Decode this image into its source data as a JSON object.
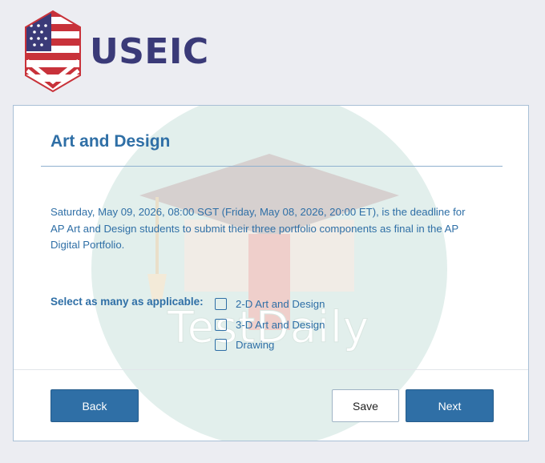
{
  "header": {
    "logo_text": "USEIC"
  },
  "card": {
    "title": "Art and Design",
    "deadline_text": "Saturday, May 09, 2026, 08:00 SGT (Friday, May 08, 2026, 20:00 ET), is the deadline for AP Art and Design students to submit their three portfolio components as final in the AP Digital Portfolio.",
    "select_label": "Select as many as applicable:",
    "options": [
      {
        "label": "2-D Art and Design",
        "checked": false
      },
      {
        "label": "3-D Art and Design",
        "checked": false
      },
      {
        "label": "Drawing",
        "checked": false
      }
    ]
  },
  "buttons": {
    "back": "Back",
    "save": "Save",
    "next": "Next"
  },
  "watermark": {
    "text": "TestDaily"
  },
  "colors": {
    "accent": "#2f6fa6",
    "logo_text": "#3a3a78",
    "page_bg": "#ecedf2"
  }
}
